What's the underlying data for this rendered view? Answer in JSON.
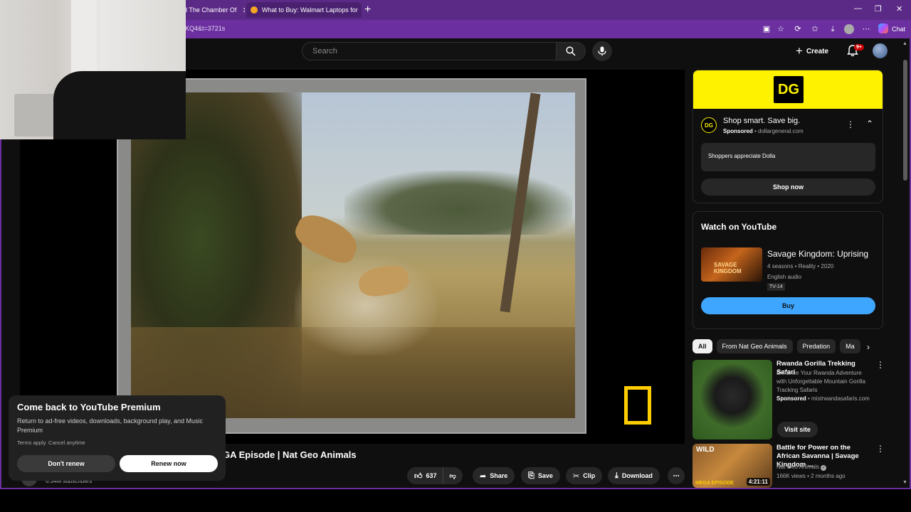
{
  "browser": {
    "tabs": [
      {
        "title": "d The Chamber Of"
      },
      {
        "title": "What to Buy: Walmart Laptops for"
      }
    ],
    "url": "KQ4&t=3721s",
    "chat_label": "Chat"
  },
  "header": {
    "search_placeholder": "Search",
    "create_label": "Create",
    "notif_badge": "9+"
  },
  "video": {
    "title": "GA Episode | Nat Geo Animals",
    "subscribers": "6.34M subscribers",
    "actions": {
      "likes": "637",
      "share": "Share",
      "save": "Save",
      "clip": "Clip",
      "download": "Download"
    }
  },
  "premium_popup": {
    "title": "Come back to YouTube Premium",
    "description": "Return to ad-free videos, downloads, background play, and Music Premium",
    "terms": "Terms apply. Cancel anytime",
    "dont_renew": "Don't renew",
    "renew_now": "Renew now"
  },
  "ad": {
    "logo": "DG",
    "title": "Shop smart. Save big.",
    "sponsored": "Sponsored",
    "domain": "dollargeneral.com",
    "box_text": "Shoppers appreciate Dolla",
    "cta": "Shop now"
  },
  "watch_on_youtube": {
    "heading": "Watch on YouTube",
    "poster_text": "SAVAGE KINGDOM",
    "title": "Savage Kingdom: Uprising",
    "meta1": "4 seasons • Reality • 2020",
    "meta2": "English audio",
    "rating": "TV-14",
    "cta": "Buy"
  },
  "chips": [
    "All",
    "From Nat Geo Animals",
    "Predation",
    "Ma"
  ],
  "recommendations": [
    {
      "title": "Rwanda Gorilla Trekking Safari",
      "description": "Enhance Your Rwanda Adventure with Unforgettable Mountain Gorilla Tracking Safaris",
      "sponsored": "Sponsored",
      "domain": "mistrwandasafaris.com",
      "cta": "Visit site"
    },
    {
      "title": "Battle for Power on the African Savanna | Savage Kingdom ...",
      "channel": "Nat Geo Animals",
      "stats": "166K views • 2 months ago",
      "duration": "4:21:11",
      "thumb_wild": "WILD",
      "thumb_mega": "MEGA EPISODE"
    }
  ],
  "colors": {
    "browser_frame": "#6b2fa0",
    "dg_yellow": "#fff200",
    "buy_blue": "#3ea6ff",
    "natgeo_yellow": "#ffcd00"
  }
}
